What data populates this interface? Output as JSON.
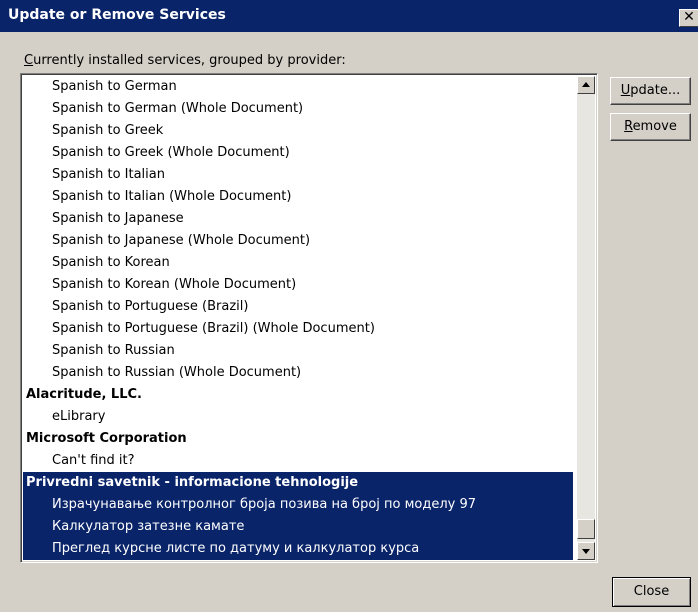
{
  "window": {
    "title": "Update or Remove Services",
    "close_glyph": "✕"
  },
  "header": {
    "label_accel": "C",
    "label_rest": "urrently installed services, grouped by provider:"
  },
  "list": {
    "rows": [
      {
        "text": "Spanish to German",
        "kind": "item",
        "selected": false
      },
      {
        "text": "Spanish to German (Whole Document)",
        "kind": "item",
        "selected": false
      },
      {
        "text": "Spanish to Greek",
        "kind": "item",
        "selected": false
      },
      {
        "text": "Spanish to Greek (Whole Document)",
        "kind": "item",
        "selected": false
      },
      {
        "text": "Spanish to Italian",
        "kind": "item",
        "selected": false
      },
      {
        "text": "Spanish to Italian (Whole Document)",
        "kind": "item",
        "selected": false
      },
      {
        "text": "Spanish to Japanese",
        "kind": "item",
        "selected": false
      },
      {
        "text": "Spanish to Japanese (Whole Document)",
        "kind": "item",
        "selected": false
      },
      {
        "text": "Spanish to Korean",
        "kind": "item",
        "selected": false
      },
      {
        "text": "Spanish to Korean (Whole Document)",
        "kind": "item",
        "selected": false
      },
      {
        "text": "Spanish to Portuguese (Brazil)",
        "kind": "item",
        "selected": false
      },
      {
        "text": "Spanish to Portuguese (Brazil) (Whole Document)",
        "kind": "item",
        "selected": false
      },
      {
        "text": "Spanish to Russian",
        "kind": "item",
        "selected": false
      },
      {
        "text": "Spanish to Russian (Whole Document)",
        "kind": "item",
        "selected": false
      },
      {
        "text": "Alacritude, LLC.",
        "kind": "group",
        "selected": false
      },
      {
        "text": "eLibrary",
        "kind": "item",
        "selected": false
      },
      {
        "text": "Microsoft Corporation",
        "kind": "group",
        "selected": false
      },
      {
        "text": "Can't find it?",
        "kind": "item",
        "selected": false
      },
      {
        "text": "Privredni savetnik - informacione tehnologije",
        "kind": "group",
        "selected": true
      },
      {
        "text": "Израчунавање контролног броја позива на број по моделу 97",
        "kind": "item",
        "selected": true
      },
      {
        "text": "Калкулатор затезне камате",
        "kind": "item",
        "selected": true
      },
      {
        "text": "Преглед курсне листе по датуму и калкулатор курса",
        "kind": "item",
        "selected": true
      }
    ]
  },
  "buttons": {
    "update_accel": "U",
    "update_rest": "pdate...",
    "remove_accel": "R",
    "remove_rest": "emove",
    "close": "Close"
  },
  "icons": {
    "scroll_up": "scroll-up-arrow-icon",
    "scroll_down": "scroll-down-arrow-icon"
  },
  "colors": {
    "selection": "#0a246a",
    "dialog_face": "#d4d0c8"
  }
}
